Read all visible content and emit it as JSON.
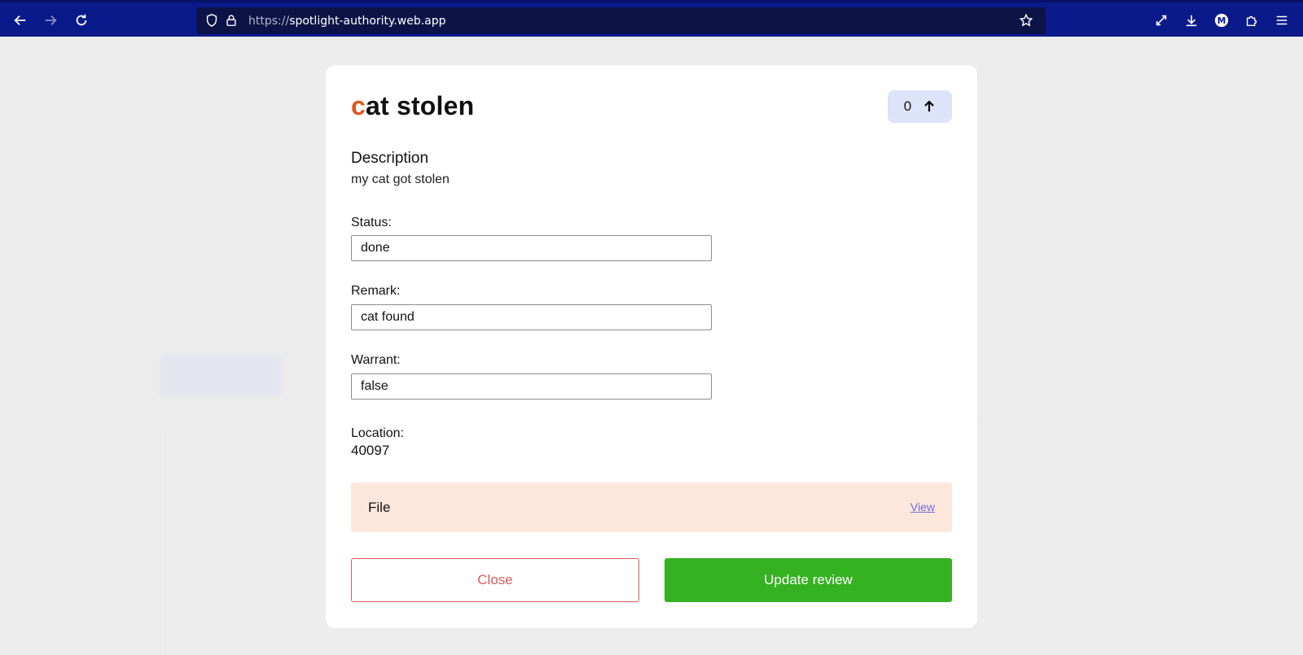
{
  "browser": {
    "url_protocol": "https://",
    "url_host": "spotlight-authority.web.app",
    "icons": [
      "back-icon",
      "forward-icon",
      "reload-icon",
      "shield-icon",
      "lock-icon",
      "star-icon",
      "expand-icon",
      "download-icon",
      "profile-icon",
      "extensions-icon",
      "menu-icon"
    ],
    "profile_initial": "M"
  },
  "modal": {
    "title_first": "c",
    "title_rest": "at stolen",
    "vote_count": "0",
    "description_heading": "Description",
    "description_text": "my cat got stolen",
    "status_label": "Status:",
    "status_value": "done",
    "remark_label": "Remark:",
    "remark_value": "cat found",
    "warrant_label": "Warrant:",
    "warrant_value": "false",
    "location_label": "Location:",
    "location_value": "40097",
    "file_label": "File",
    "file_link": "View",
    "close_label": "Close",
    "update_label": "Update review"
  },
  "colors": {
    "browser_bar": "#0b1a8a",
    "title_accent": "#e2581d",
    "vote_bg": "#dde3f8",
    "file_bg": "#fde7dd",
    "close_border": "#e05a5a",
    "update_bg": "#36b121"
  }
}
